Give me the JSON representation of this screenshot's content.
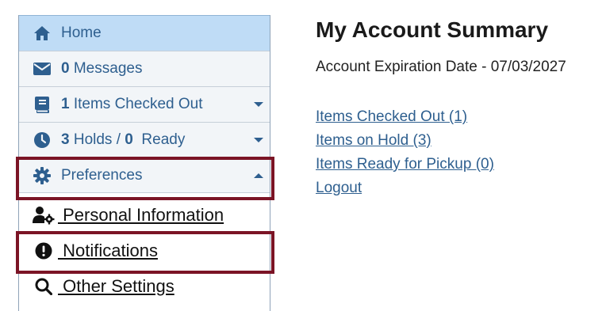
{
  "sidebar": {
    "home_label": "Home",
    "messages_count": "0",
    "messages_label": "Messages",
    "checked_out_count": "1",
    "checked_out_label": "Items Checked Out",
    "holds_count": "3",
    "holds_mid": "Holds /",
    "holds_ready_count": "0",
    "holds_ready_label": "Ready",
    "preferences_label": "Preferences",
    "sub_items": {
      "personal_information": " Personal Information",
      "notifications": " Notifications",
      "other_settings": " Other Settings"
    }
  },
  "main": {
    "title": "My Account Summary",
    "expiration": "Account Expiration Date - 07/03/2027",
    "links": {
      "checked_out": "Items Checked Out (1)",
      "on_hold": "Items on Hold (3)",
      "ready_pickup": "Items Ready for Pickup (0)",
      "logout": "Logout"
    }
  },
  "colors": {
    "accent": "#2e5f8f",
    "active_bg": "#bfdcf6",
    "highlight_border": "#7b1425"
  },
  "icons": {
    "home": "home-icon",
    "messages": "envelope-icon",
    "checked_out": "book-icon",
    "holds": "clock-icon",
    "preferences": "gear-icon",
    "personal_information": "user-gear-icon",
    "notifications": "exclamation-circle-icon",
    "other_settings": "search-icon"
  }
}
